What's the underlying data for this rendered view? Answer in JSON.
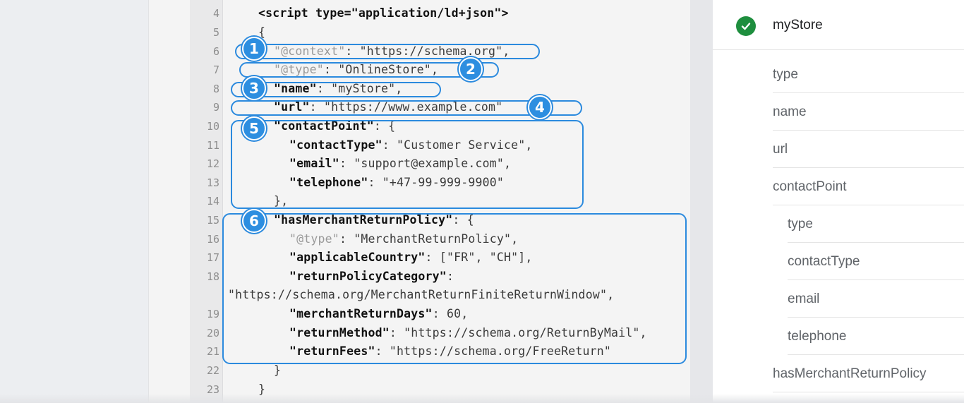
{
  "code": {
    "lines": [
      {
        "num": "4",
        "text": "<script type=\"application/ld+json\">"
      },
      {
        "num": "5",
        "text": "{"
      },
      {
        "num": "6",
        "key": "\"@context\"",
        "value": ": \"https://schema.org\","
      },
      {
        "num": "7",
        "key": "\"@type\"",
        "value": ": \"OnlineStore\","
      },
      {
        "num": "8",
        "key": "\"name\"",
        "value": ": \"myStore\","
      },
      {
        "num": "9",
        "key": "\"url\"",
        "value": ": \"https://www.example.com\""
      },
      {
        "num": "10",
        "key": "\"contactPoint\"",
        "value": ": {"
      },
      {
        "num": "11",
        "key": "\"contactType\"",
        "value": ": \"Customer Service\","
      },
      {
        "num": "12",
        "key": "\"email\"",
        "value": ": \"support@example.com\","
      },
      {
        "num": "13",
        "key": "\"telephone\"",
        "value": ": \"+47-99-999-9900\""
      },
      {
        "num": "14",
        "text": "},"
      },
      {
        "num": "15",
        "key": "\"hasMerchantReturnPolicy\"",
        "value": ": {"
      },
      {
        "num": "16",
        "key": "\"@type\"",
        "value": ": \"MerchantReturnPolicy\","
      },
      {
        "num": "17",
        "key": "\"applicableCountry\"",
        "value": ": [\"FR\", \"CH\"],"
      },
      {
        "num": "18",
        "key": "\"returnPolicyCategory\"",
        "value": ":"
      },
      {
        "num": "",
        "text": "\"https://schema.org/MerchantReturnFiniteReturnWindow\","
      },
      {
        "num": "19",
        "key": "\"merchantReturnDays\"",
        "value": ": 60,"
      },
      {
        "num": "20",
        "key": "\"returnMethod\"",
        "value": ": \"https://schema.org/ReturnByMail\","
      },
      {
        "num": "21",
        "key": "\"returnFees\"",
        "value": ": \"https://schema.org/FreeReturn\""
      },
      {
        "num": "22",
        "text": "}"
      },
      {
        "num": "23",
        "text": "}"
      }
    ]
  },
  "badges": [
    "1",
    "2",
    "3",
    "4",
    "5",
    "6"
  ],
  "tree": {
    "status_icon": "check-circle-icon",
    "status_color": "#1e8e3e",
    "title": "myStore",
    "items": [
      {
        "label": "type",
        "level": 1
      },
      {
        "label": "name",
        "level": 1
      },
      {
        "label": "url",
        "level": 1
      },
      {
        "label": "contactPoint",
        "level": 1
      },
      {
        "label": "type",
        "level": 2
      },
      {
        "label": "contactType",
        "level": 2
      },
      {
        "label": "email",
        "level": 2
      },
      {
        "label": "telephone",
        "level": 2
      },
      {
        "label": "hasMerchantReturnPolicy",
        "level": 1
      }
    ]
  },
  "accent_color": "#2b8ade"
}
